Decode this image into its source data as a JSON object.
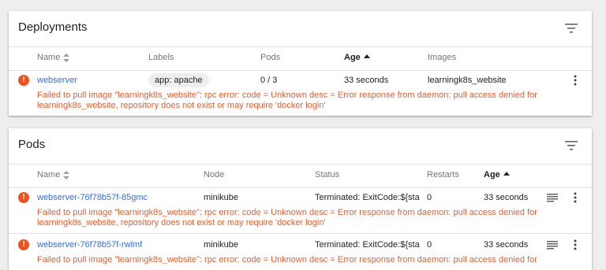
{
  "deployments": {
    "title": "Deployments",
    "columns": {
      "name": "Name",
      "labels": "Labels",
      "pods": "Pods",
      "age": "Age",
      "images": "Images"
    },
    "rows": [
      {
        "name": "webserver",
        "label": "app: apache",
        "pods": "0 / 3",
        "age": "33 seconds",
        "images": "learningk8s_website",
        "error_line1": "Failed to pull image \"learningk8s_website\": rpc error: code = Unknown desc = Error response from daemon: pull access denied for",
        "error_line2": "learningk8s_website, repository does not exist or may require 'docker login'"
      }
    ]
  },
  "pods": {
    "title": "Pods",
    "columns": {
      "name": "Name",
      "node": "Node",
      "status": "Status",
      "restarts": "Restarts",
      "age": "Age"
    },
    "rows": [
      {
        "name": "webserver-76f78b57f-85gmc",
        "node": "minikube",
        "status": "Terminated: ExitCode:${sta",
        "restarts": "0",
        "age": "33 seconds",
        "error_line1": "Failed to pull image \"learningk8s_website\": rpc error: code = Unknown desc = Error response from daemon: pull access denied for",
        "error_line2": "learningk8s_website, repository does not exist or may require 'docker login'"
      },
      {
        "name": "webserver-76f78b57f-rwlmf",
        "node": "minikube",
        "status": "Terminated: ExitCode:${sta",
        "restarts": "0",
        "age": "33 seconds",
        "error_line1": "Failed to pull image \"learningk8s_website\": rpc error: code = Unknown desc = Error response from daemon: pull access denied for"
      }
    ]
  },
  "colors": {
    "error": "#ef5b2a",
    "link": "#326de6",
    "background": "#eeeeee"
  },
  "icons": {
    "filter": "filter-icon",
    "sort": "sort-icon",
    "error": "error-icon",
    "more": "kebab-icon",
    "logs": "logs-icon"
  }
}
